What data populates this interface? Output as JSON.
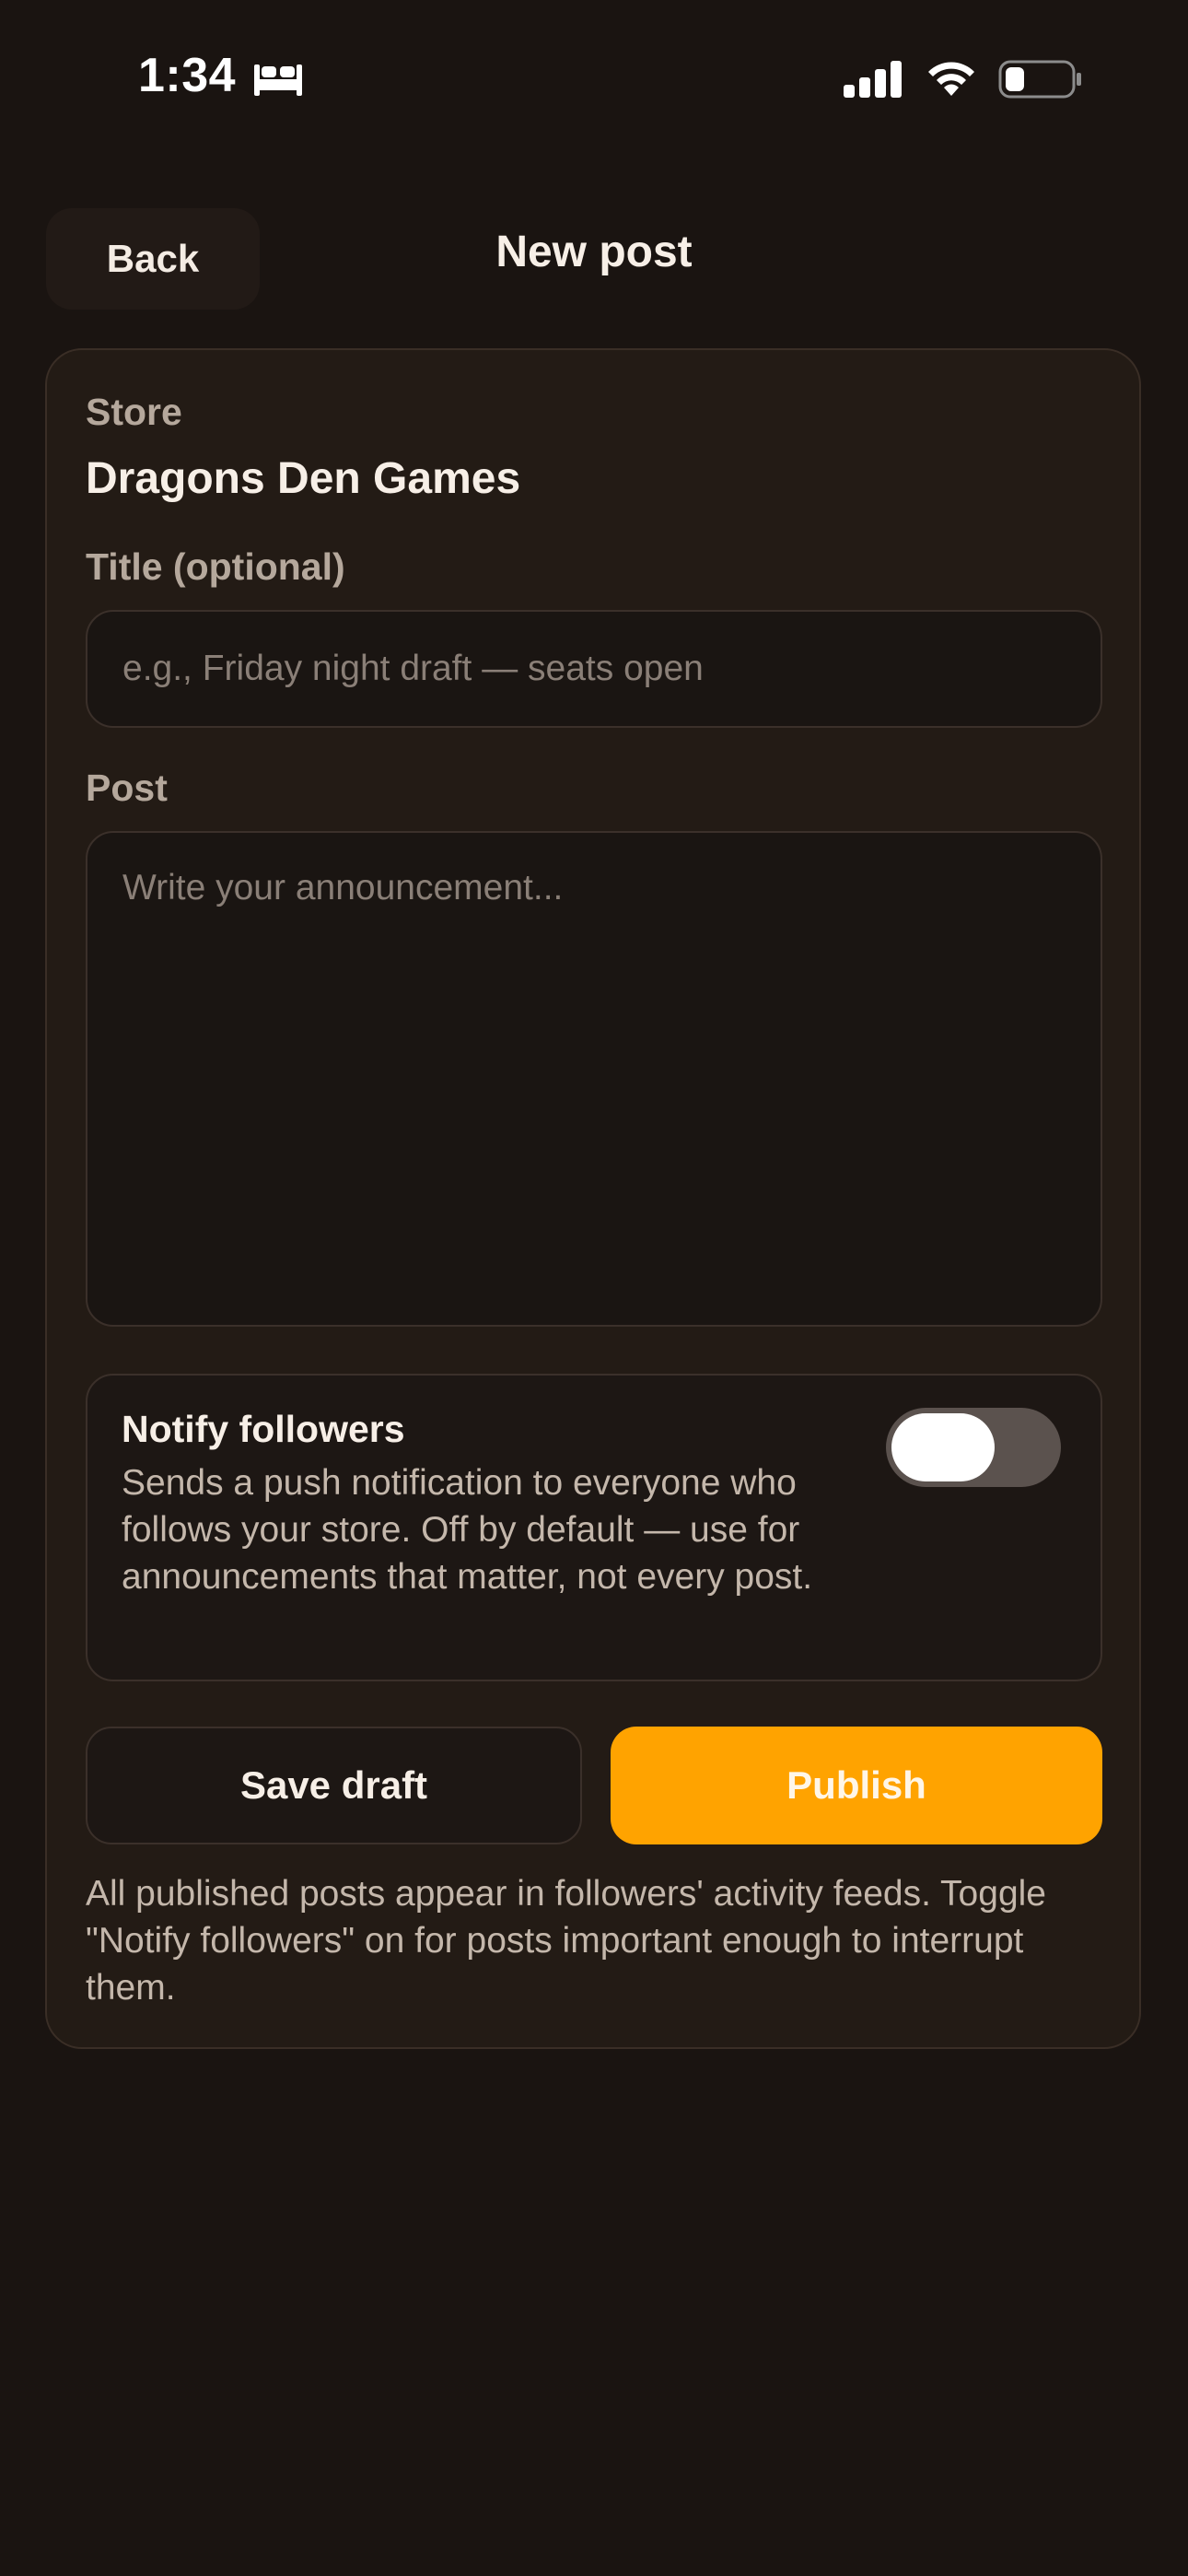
{
  "status_bar": {
    "time": "1:34",
    "focus_icon": "bed-icon",
    "signal_icon": "cellular-signal-icon",
    "wifi_icon": "wifi-icon",
    "battery_icon": "battery-icon"
  },
  "header": {
    "back_label": "Back",
    "title": "New post"
  },
  "form": {
    "store_label": "Store",
    "store_name": "Dragons Den Games",
    "title_label": "Title (optional)",
    "title_value": "",
    "title_placeholder": "e.g., Friday night draft — seats open",
    "post_label": "Post",
    "post_value": "",
    "post_placeholder": "Write your announcement..."
  },
  "notify": {
    "title": "Notify followers",
    "description": "Sends a push notification to everyone who follows your store. Off by default — use for announcements that matter, not every post.",
    "enabled": false
  },
  "actions": {
    "save_draft_label": "Save draft",
    "publish_label": "Publish"
  },
  "footnote": "All published posts appear in followers' activity feeds. Toggle \"Notify followers\" on for posts important enough to interrupt them.",
  "colors": {
    "background": "#1a1411",
    "card": "#231b15",
    "accent": "#ffa300",
    "toggle_track_off": "#5b524e"
  }
}
